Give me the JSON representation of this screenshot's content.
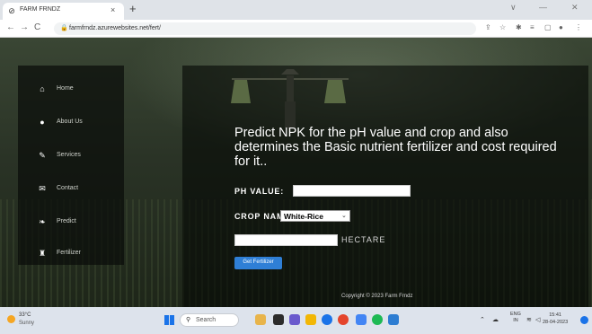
{
  "browser": {
    "tab_title": "FARM FRNDZ",
    "tab_close": "×",
    "new_tab": "+",
    "url": "farmfrndz.azurewebsites.net/fert/",
    "window_controls": [
      "∨",
      "—",
      "✕"
    ],
    "back": "←",
    "forward": "→",
    "reload": "C"
  },
  "sidebar": {
    "items": [
      {
        "label": "Home",
        "icon": "home-icon",
        "glyph": "⌂"
      },
      {
        "label": "About Us",
        "icon": "user-icon",
        "glyph": "●"
      },
      {
        "label": "Services",
        "icon": "pencil-icon",
        "glyph": "✎"
      },
      {
        "label": "Contact",
        "icon": "envelope-icon",
        "glyph": "✉"
      },
      {
        "label": "Predict",
        "icon": "leaf-icon",
        "glyph": "❧"
      },
      {
        "label": "Fertilizer",
        "icon": "flask-icon",
        "glyph": "♜"
      }
    ]
  },
  "main": {
    "heading": "Predict NPK for the pH value and crop and also determines the Basic nutrient fertilizer and cost required for it..",
    "ph_label": "PH VALUE:",
    "crop_label": "CROP NAME:",
    "crop_selected": "White-Rice",
    "hectare_label": "HECTARE",
    "submit_label": "Get Fertilizer",
    "copyright": "Copyright © 2023 Farm Frndz"
  },
  "taskbar": {
    "temp": "33°C",
    "weather": "Sunny",
    "search_label": "Search",
    "lang_line1": "ENG",
    "lang_line2": "IN",
    "time": "15:41",
    "date": "28-04-2023"
  },
  "colors": {
    "button_blue": "#2f7fd6",
    "overlay": "#0a0c0a"
  }
}
